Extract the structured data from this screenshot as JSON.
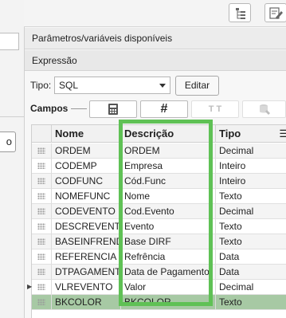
{
  "left": {
    "button_label": "o"
  },
  "panel": {
    "title": "Parâmetros/variáveis disponíveis",
    "expression_label": "Expressão",
    "tipo_label": "Tipo:",
    "tipo_value": "SQL",
    "editar_label": "Editar",
    "campos_label": "Campos"
  },
  "toolbar": {
    "icons": [
      "calculator-icon",
      "hash-icon",
      "text-size-icon",
      "database-icon"
    ],
    "hash_glyph": "#",
    "tt_glyph": "T T"
  },
  "grid": {
    "headers": [
      "Nome",
      "Descrição",
      "Tipo"
    ],
    "rows": [
      {
        "nome": "ORDEM",
        "descricao": "ORDEM",
        "tipo": "Decimal"
      },
      {
        "nome": "CODEMP",
        "descricao": "Empresa",
        "tipo": "Inteiro"
      },
      {
        "nome": "CODFUNC",
        "descricao": "Cód.Func",
        "tipo": "Inteiro"
      },
      {
        "nome": "NOMEFUNC",
        "descricao": "Nome",
        "tipo": "Texto"
      },
      {
        "nome": "CODEVENTO",
        "descricao": "Cod.Evento",
        "tipo": "Decimal"
      },
      {
        "nome": "DESCREVENTO",
        "descricao": "Evento",
        "tipo": "Texto"
      },
      {
        "nome": "BASEINFREND",
        "descricao": "Base DIRF",
        "tipo": "Texto"
      },
      {
        "nome": "REFERENCIA",
        "descricao": "Refrência",
        "tipo": "Data"
      },
      {
        "nome": "DTPAGAMENTO",
        "descricao": "Data de Pagamento",
        "tipo": "Data"
      },
      {
        "nome": "VLREVENTO",
        "descricao": "Valor",
        "tipo": "Decimal"
      },
      {
        "nome": "BKCOLOR",
        "descricao": "BKCOLOR",
        "tipo": "Texto"
      }
    ],
    "selected_row": 10
  },
  "colors": {
    "highlight": "#5fc155",
    "selected_row": "#a7c9a4"
  }
}
